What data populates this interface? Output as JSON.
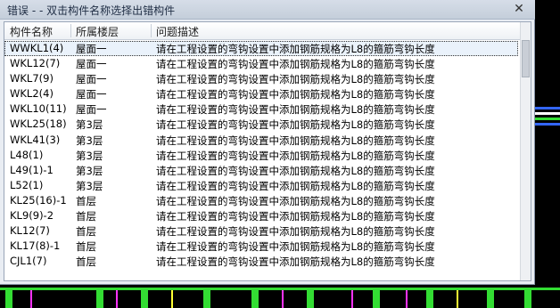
{
  "window": {
    "title": "错误 - - 双击构件名称选择出错构件",
    "close_glyph": "✕"
  },
  "table": {
    "columns": [
      "构件名称",
      "所属楼层",
      "问题描述"
    ],
    "rows": [
      {
        "name": "WWKL1(4)",
        "floor": "屋面一",
        "desc": "请在工程设置的弯钩设置中添加钢筋规格为L8的箍筋弯钩长度"
      },
      {
        "name": "WKL12(7)",
        "floor": "屋面一",
        "desc": "请在工程设置的弯钩设置中添加钢筋规格为L8的箍筋弯钩长度"
      },
      {
        "name": "WKL7(9)",
        "floor": "屋面一",
        "desc": "请在工程设置的弯钩设置中添加钢筋规格为L8的箍筋弯钩长度"
      },
      {
        "name": "WKL2(4)",
        "floor": "屋面一",
        "desc": "请在工程设置的弯钩设置中添加钢筋规格为L8的箍筋弯钩长度"
      },
      {
        "name": "WKL10(11)",
        "floor": "屋面一",
        "desc": "请在工程设置的弯钩设置中添加钢筋规格为L8的箍筋弯钩长度"
      },
      {
        "name": "WKL25(18)",
        "floor": "第3层",
        "desc": "请在工程设置的弯钩设置中添加钢筋规格为L8的箍筋弯钩长度"
      },
      {
        "name": "WKL41(3)",
        "floor": "第3层",
        "desc": "请在工程设置的弯钩设置中添加钢筋规格为L8的箍筋弯钩长度"
      },
      {
        "name": "L48(1)",
        "floor": "第3层",
        "desc": "请在工程设置的弯钩设置中添加钢筋规格为L8的箍筋弯钩长度"
      },
      {
        "name": "L49(1)-1",
        "floor": "第3层",
        "desc": "请在工程设置的弯钩设置中添加钢筋规格为L8的箍筋弯钩长度"
      },
      {
        "name": "L52(1)",
        "floor": "第3层",
        "desc": "请在工程设置的弯钩设置中添加钢筋规格为L8的箍筋弯钩长度"
      },
      {
        "name": "KL25(16)-1",
        "floor": "首层",
        "desc": "请在工程设置的弯钩设置中添加钢筋规格为L8的箍筋弯钩长度"
      },
      {
        "name": "KL9(9)-2",
        "floor": "首层",
        "desc": "请在工程设置的弯钩设置中添加钢筋规格为L8的箍筋弯钩长度"
      },
      {
        "name": "KL12(7)",
        "floor": "首层",
        "desc": "请在工程设置的弯钩设置中添加钢筋规格为L8的箍筋弯钩长度"
      },
      {
        "name": "KL17(8)-1",
        "floor": "首层",
        "desc": "请在工程设置的弯钩设置中添加钢筋规格为L8的箍筋弯钩长度"
      },
      {
        "name": "CJL1(7)",
        "floor": "首层",
        "desc": "请在工程设置的弯钩设置中添加钢筋规格为L8的箍筋弯钩长度"
      }
    ]
  },
  "colors": {
    "cad_green": "#33dd33",
    "cad_magenta": "#ff33ff",
    "cad_yellow": "#ffff33",
    "cad_blue": "#3366ff",
    "cad_white": "#ffffff"
  }
}
